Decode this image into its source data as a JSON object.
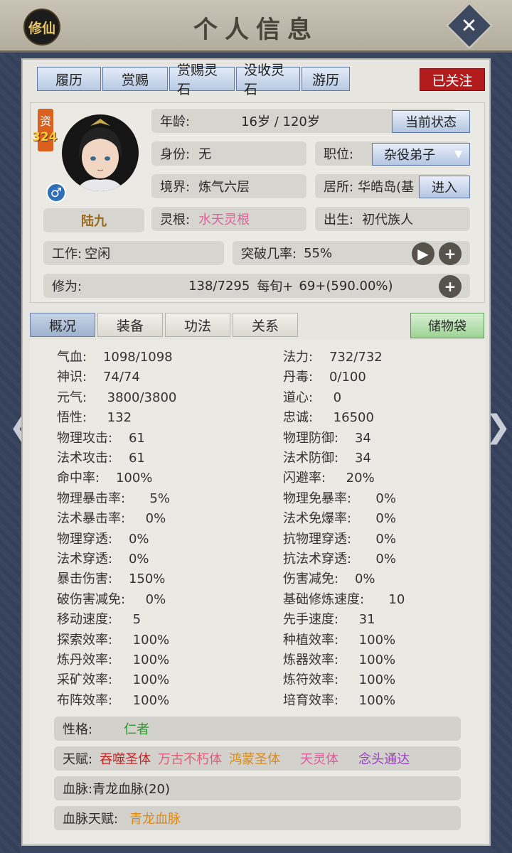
{
  "header": {
    "badge": "修仙",
    "title": "个人信息",
    "close": "✕"
  },
  "top_tabs": [
    "履历",
    "赏赐",
    "赏赐灵石",
    "没收灵石",
    "游历"
  ],
  "followed": "已关注",
  "profile": {
    "zi": "资",
    "zi_value": "324",
    "gender_icon": "♂",
    "name": "陆九",
    "age_label": "年龄:",
    "age_value": "16岁 / 120岁",
    "status_btn": "当前状态",
    "identity_label": "身份:",
    "identity_value": "无",
    "post_label": "职位:",
    "post_value": "杂役弟子",
    "realm_label": "境界:",
    "realm_value": "炼气六层",
    "residence_label": "居所:",
    "residence_value": "华皓岛(基",
    "enter_btn": "进入",
    "root_label": "灵根:",
    "root_value": "水天灵根",
    "birth_label": "出生:",
    "birth_value": "初代族人",
    "work_label": "工作:",
    "work_value": "空闲",
    "breakthrough_label": "突破几率:",
    "breakthrough_value": "55%",
    "cultivation_label": "修为:",
    "cultivation_value": "138/7295",
    "per_tick_label": "每旬+",
    "per_tick_value": "69+(590.00%)"
  },
  "sub_tabs": [
    "概况",
    "装备",
    "功法",
    "关系"
  ],
  "bag": "储物袋",
  "stats_left": [
    "气血:    1098/1098",
    "神识:    74/74",
    "元气:     3800/3800",
    "悟性:     132",
    "物理攻击:    61",
    "法术攻击:    61",
    "命中率:    100%",
    "物理暴击率:      5%",
    "法术暴击率:     0%",
    "物理穿透:    0%",
    "法术穿透:    0%",
    "暴击伤害:    150%",
    "破伤害减免:     0%",
    "移动速度:     5",
    "探索效率:     100%",
    "炼丹效率:     100%",
    "采矿效率:     100%",
    "布阵效率:     100%"
  ],
  "stats_right": [
    "法力:    732/732",
    "丹毒:    0/100",
    "道心:     0",
    "忠诚:     16500",
    "物理防御:    34",
    "法术防御:    34",
    "闪避率:     20%",
    "物理免暴率:      0%",
    "法术免爆率:      0%",
    "抗物理穿透:      0%",
    "抗法术穿透:      0%",
    "伤害减免:    0%",
    "基础修炼速度:      10",
    "先手速度:     31",
    "种植效率:     100%",
    "炼器效率:     100%",
    "炼符效率:     100%",
    "培育效率:     100%"
  ],
  "personality_label": "性格:",
  "personality_value": "仁者",
  "talent_label": "天赋:",
  "talents": [
    "吞噬圣体",
    "万古不朽体",
    "鸿蒙圣体",
    "天灵体",
    "念头通达"
  ],
  "talent_colors": [
    "#cc2222",
    "#e0607a",
    "#d98a1a",
    "#e05a9a",
    "#9a3fc7"
  ],
  "bloodline_label": "血脉:",
  "bloodline_value": "青龙血脉(20)",
  "bloodline_talent_label": "血脉天赋:",
  "bloodline_talent_value": "青龙血脉",
  "nav": {
    "left": "❮",
    "right": "❯"
  }
}
